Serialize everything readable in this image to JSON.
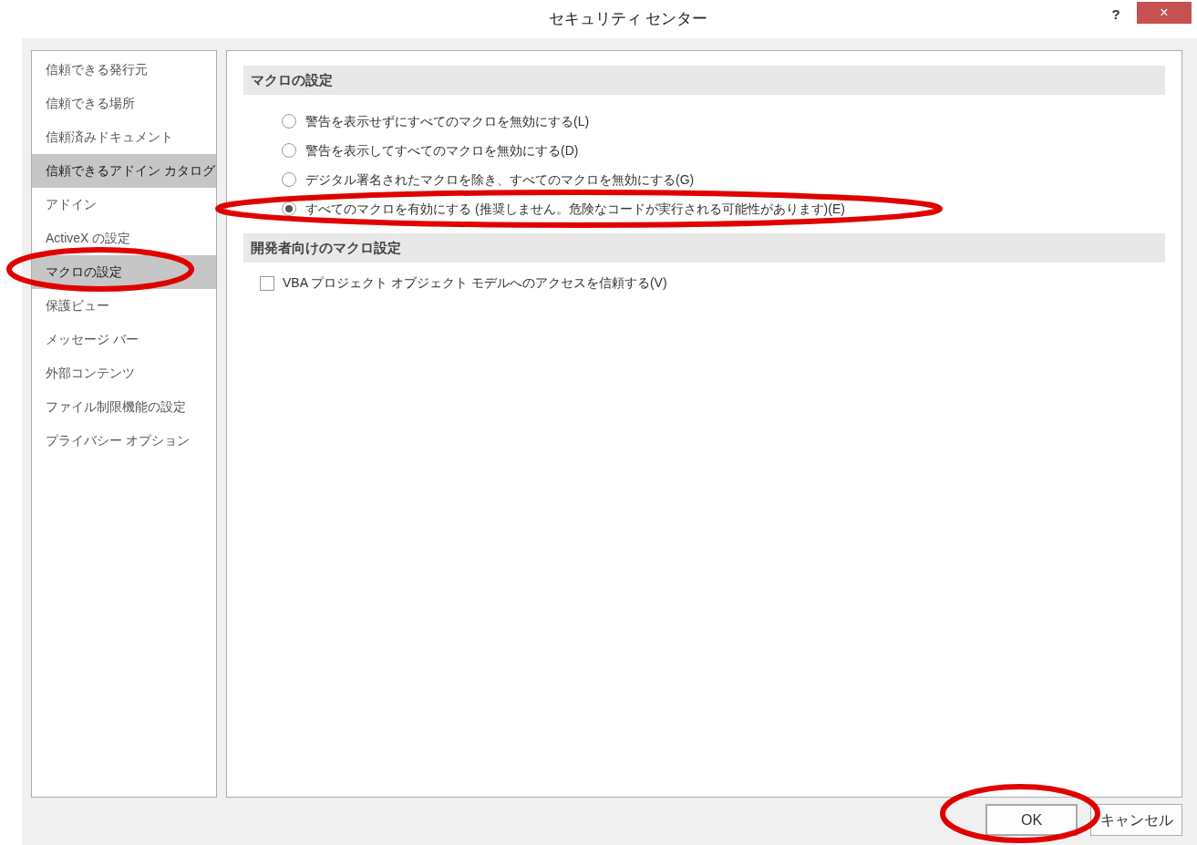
{
  "window": {
    "title": "セキュリティ センター",
    "help": "?",
    "close": "×"
  },
  "sidebar": {
    "items": [
      {
        "label": "信頼できる発行元",
        "selected": false,
        "circled": false
      },
      {
        "label": "信頼できる場所",
        "selected": false,
        "circled": false
      },
      {
        "label": "信頼済みドキュメント",
        "selected": false,
        "circled": false
      },
      {
        "label": "信頼できるアドイン カタログ",
        "selected": true,
        "circled": false
      },
      {
        "label": "アドイン",
        "selected": false,
        "circled": false
      },
      {
        "label": "ActiveX の設定",
        "selected": false,
        "circled": false
      },
      {
        "label": "マクロの設定",
        "selected": true,
        "circled": true
      },
      {
        "label": "保護ビュー",
        "selected": false,
        "circled": false
      },
      {
        "label": "メッセージ バー",
        "selected": false,
        "circled": false
      },
      {
        "label": "外部コンテンツ",
        "selected": false,
        "circled": false
      },
      {
        "label": "ファイル制限機能の設定",
        "selected": false,
        "circled": false
      },
      {
        "label": "プライバシー オプション",
        "selected": false,
        "circled": false
      }
    ]
  },
  "macro_settings": {
    "heading": "マクロの設定",
    "options": [
      {
        "label": "警告を表示せずにすべてのマクロを無効にする(L)",
        "selected": false,
        "circled": false
      },
      {
        "label": "警告を表示してすべてのマクロを無効にする(D)",
        "selected": false,
        "circled": false
      },
      {
        "label": "デジタル署名されたマクロを除き、すべてのマクロを無効にする(G)",
        "selected": false,
        "circled": false
      },
      {
        "label": "すべてのマクロを有効にする (推奨しません。危険なコードが実行される可能性があります)(E)",
        "selected": true,
        "circled": true
      }
    ]
  },
  "developer_settings": {
    "heading": "開発者向けのマクロ設定",
    "checkbox": {
      "label": "VBA プロジェクト オブジェクト モデルへのアクセスを信頼する(V)",
      "checked": false
    }
  },
  "buttons": [
    {
      "label": "OK",
      "circled": true
    },
    {
      "label": "キャンセル",
      "circled": false
    }
  ]
}
